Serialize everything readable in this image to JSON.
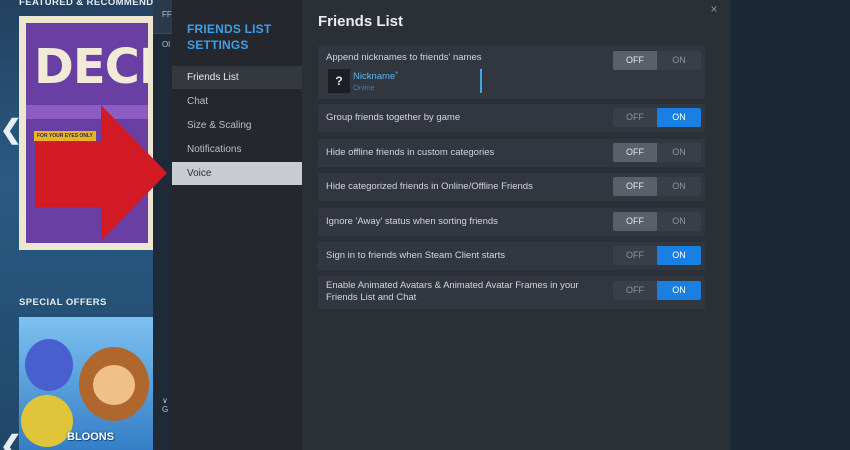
{
  "store": {
    "featured_heading": "FEATURED & RECOMMENDED",
    "special_heading": "SPECIAL OFFERS",
    "featured_capsule_text": "DECK",
    "featured_capsule_tag": "FOR YOUR EYES ONLY",
    "special_capsule_text": "BLOONS",
    "nav_prev": "❮",
    "nav_next": "❮"
  },
  "behind_window": {
    "top_text": "FF",
    "row_text": "Ol",
    "bottom_text": "∨ G"
  },
  "dialog": {
    "sidebar": {
      "title": "FRIENDS LIST SETTINGS",
      "items": [
        {
          "label": "Friends List"
        },
        {
          "label": "Chat"
        },
        {
          "label": "Size & Scaling"
        },
        {
          "label": "Notifications"
        },
        {
          "label": "Voice"
        }
      ]
    },
    "close_icon": "×",
    "content": {
      "title": "Friends List",
      "nickname_preview": {
        "avatar": "?",
        "name": "Nickname",
        "star": "*",
        "status": "Online"
      },
      "toggle_off_label": "OFF",
      "toggle_on_label": "ON",
      "settings": [
        {
          "label": "Append nicknames to friends' names",
          "value": "OFF"
        },
        {
          "label": "Group friends together by game",
          "value": "ON"
        },
        {
          "label": "Hide offline friends in custom categories",
          "value": "OFF"
        },
        {
          "label": "Hide categorized friends in Online/Offline Friends",
          "value": "OFF"
        },
        {
          "label": "Ignore 'Away' status when sorting friends",
          "value": "OFF"
        },
        {
          "label": "Sign in to friends when Steam Client starts",
          "value": "ON"
        },
        {
          "label": "Enable Animated Avatars & Animated Avatar Frames in your Friends List and Chat",
          "value": "ON"
        }
      ]
    }
  },
  "colors": {
    "accent_blue": "#1a7fe2",
    "sidebar_title": "#3f9fe6",
    "arrow_red": "#d11a24"
  }
}
